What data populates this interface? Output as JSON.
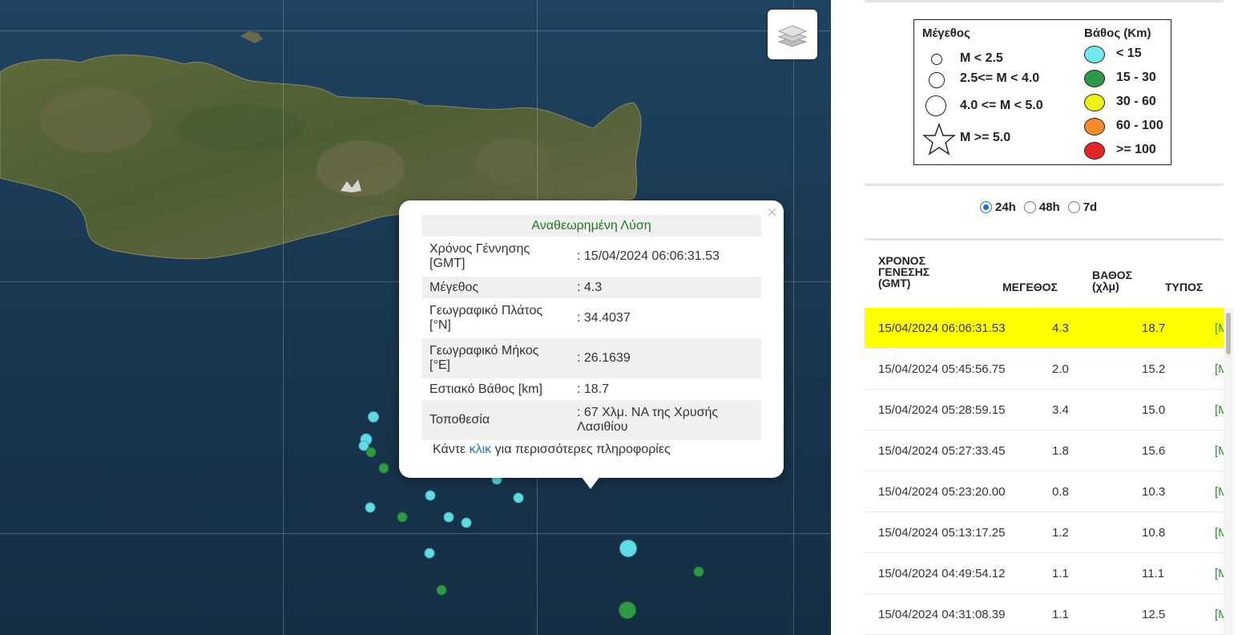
{
  "map": {
    "layers_icon": "layers-icon",
    "popup": {
      "title": "Αναθεωρημένη Λύση",
      "close_symbol": "×",
      "rows": [
        {
          "label": "Χρόνος Γέννησης [GMT]",
          "value": ": 15/04/2024 06:06:31.53"
        },
        {
          "label": "Μέγεθος",
          "value": ": 4.3"
        },
        {
          "label": "Γεωγραφικό Πλάτος [°N]",
          "value": ": 34.4037"
        },
        {
          "label": "Γεωγραφικό Μήκος [°E]",
          "value": ": 26.1639"
        },
        {
          "label": "Εστιακό Βάθος [km]",
          "value": ": 18.7"
        },
        {
          "label": "Τοποθεσία",
          "value": ": 67 Χλμ. ΝΑ της Χρυσής Λασιθίου"
        }
      ],
      "footer_before": "Κάντε ",
      "footer_link": "κλικ",
      "footer_after": " για περισσότερες πληροφορίες"
    }
  },
  "legend": {
    "magnitude_heading": "Μέγεθος",
    "depth_heading": "Βάθος (Km)",
    "magnitude_items": [
      "M < 2.5",
      "2.5<= M < 4.0",
      "4.0 <= M < 5.0",
      "M >= 5.0"
    ],
    "depth_items": [
      {
        "label": "< 15",
        "color": "#6fe8f0"
      },
      {
        "label": "15 - 30",
        "color": "#2f9a45"
      },
      {
        "label": "30 - 60",
        "color": "#f2ee1a"
      },
      {
        "label": "60 - 100",
        "color": "#f28b2a"
      },
      {
        "label": ">= 100",
        "color": "#e0262b"
      }
    ]
  },
  "time_filter": {
    "options": [
      "24h",
      "48h",
      "7d"
    ],
    "selected": "24h"
  },
  "table": {
    "headers": {
      "time": "ΧΡΟΝΟΣ ΓΕΝΕΣΗΣ (GMT)",
      "magnitude": "ΜΕΓΕΘΟΣ",
      "depth": "ΒΑΘΟΣ (χλμ)",
      "type": "ΤΥΠΟΣ"
    },
    "type_marker": "[M",
    "rows": [
      {
        "time": "15/04/2024 06:06:31.53",
        "mag": "4.3",
        "depth": "18.7",
        "selected": true
      },
      {
        "time": "15/04/2024 05:45:56.75",
        "mag": "2.0",
        "depth": "15.2"
      },
      {
        "time": "15/04/2024 05:28:59.15",
        "mag": "3.4",
        "depth": "15.0"
      },
      {
        "time": "15/04/2024 05:27:33.45",
        "mag": "1.8",
        "depth": "15.6"
      },
      {
        "time": "15/04/2024 05:23:20.00",
        "mag": "0.8",
        "depth": "10.3"
      },
      {
        "time": "15/04/2024 05:13:17.25",
        "mag": "1.2",
        "depth": "10.8"
      },
      {
        "time": "15/04/2024 04:49:54.12",
        "mag": "1.1",
        "depth": "11.1"
      },
      {
        "time": "15/04/2024 04:31:08.39",
        "mag": "1.1",
        "depth": "12.5"
      }
    ]
  }
}
